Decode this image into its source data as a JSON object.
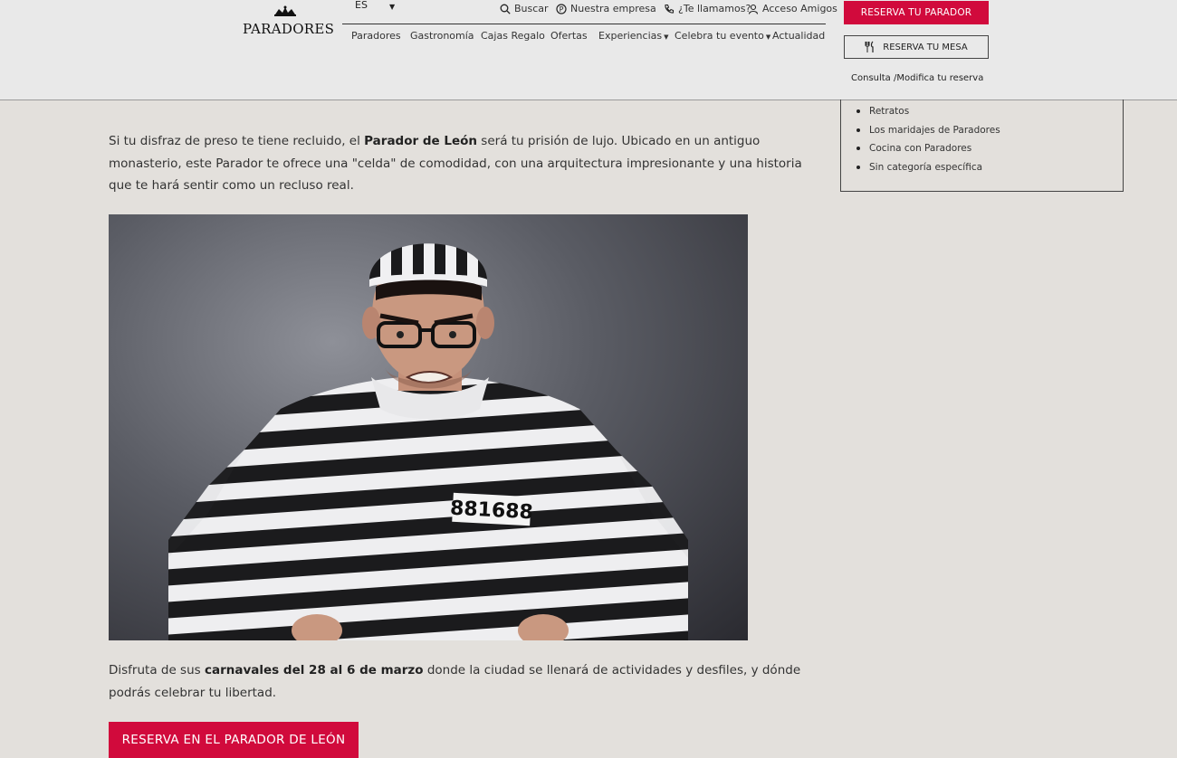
{
  "header": {
    "logo_text": "PARADORES",
    "language": "ES",
    "utility": {
      "search": "Buscar",
      "company": "Nuestra empresa",
      "call": "¿Te llamamos?",
      "friends": "Acceso Amigos"
    },
    "nav": [
      "Paradores",
      "Gastronomía",
      "Cajas Regalo",
      "Ofertas",
      "Experiencias",
      "Celebra tu evento",
      "Actualidad"
    ],
    "reserve_parador": "RESERVA TU PARADOR",
    "reserve_table": "RESERVA TU MESA",
    "manage_booking": "Consulta /Modifica tu reserva"
  },
  "sidebar": {
    "items": [
      "Retratos",
      "Los maridajes de Paradores",
      "Cocina con Paradores",
      "Sin categoría específica"
    ]
  },
  "article": {
    "p1_a": "Si tu disfraz de preso te tiene recluido, el ",
    "p1_bold": "Parador de León",
    "p1_b": " será tu prisión de lujo. Ubicado en un antiguo monasterio, este Parador te ofrece una \"celda\" de comodidad, con una arquitectura impresionante y una historia que te hará sentir como un recluso real.",
    "badge_number": "881688",
    "p2_a": "Disfruta de sus ",
    "p2_bold": "carnavales del 28 al 6 de marzo",
    "p2_b": " donde la ciudad se llenará de actividades y desfiles, y dónde podrás celebrar tu libertad.",
    "cta": "RESERVA EN EL PARADOR DE LEÓN"
  },
  "colors": {
    "brand_red": "#d10a3c",
    "page_bg": "#e3e0dc",
    "header_bg": "#e9e9e9"
  },
  "icons": [
    "crown-icon",
    "search-icon",
    "info-icon",
    "phone-icon",
    "user-icon",
    "cutlery-icon",
    "caret-down-icon"
  ]
}
